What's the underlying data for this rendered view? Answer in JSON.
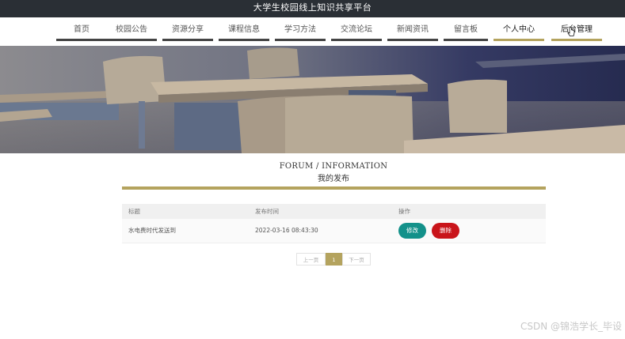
{
  "app": {
    "title": "大学生校园线上知识共享平台"
  },
  "nav": {
    "items": [
      {
        "label": "首页",
        "active": false
      },
      {
        "label": "校园公告",
        "active": false
      },
      {
        "label": "资源分享",
        "active": false
      },
      {
        "label": "课程信息",
        "active": false
      },
      {
        "label": "学习方法",
        "active": false
      },
      {
        "label": "交流论坛",
        "active": false
      },
      {
        "label": "新闻资讯",
        "active": false
      },
      {
        "label": "留言板",
        "active": false
      },
      {
        "label": "个人中心",
        "active": true
      },
      {
        "label": "后台管理",
        "active": true
      }
    ]
  },
  "section": {
    "title_en": "FORUM / INFORMATION",
    "title_cn": "我的发布"
  },
  "table": {
    "headers": [
      "标题",
      "发布时间",
      "操作"
    ],
    "rows": [
      {
        "title": "水电费时代发送到",
        "time": "2022-03-16 08:43:30",
        "edit_label": "修改",
        "delete_label": "删除"
      }
    ]
  },
  "pagination": {
    "prev_label": "上一页",
    "current_page": "1",
    "next_label": "下一页"
  },
  "watermark": "CSDN @锦浩学长_毕设",
  "colors": {
    "accent": "#b4a35e",
    "topbar": "#2a2f35",
    "edit": "#13918a",
    "delete": "#c9141a"
  }
}
